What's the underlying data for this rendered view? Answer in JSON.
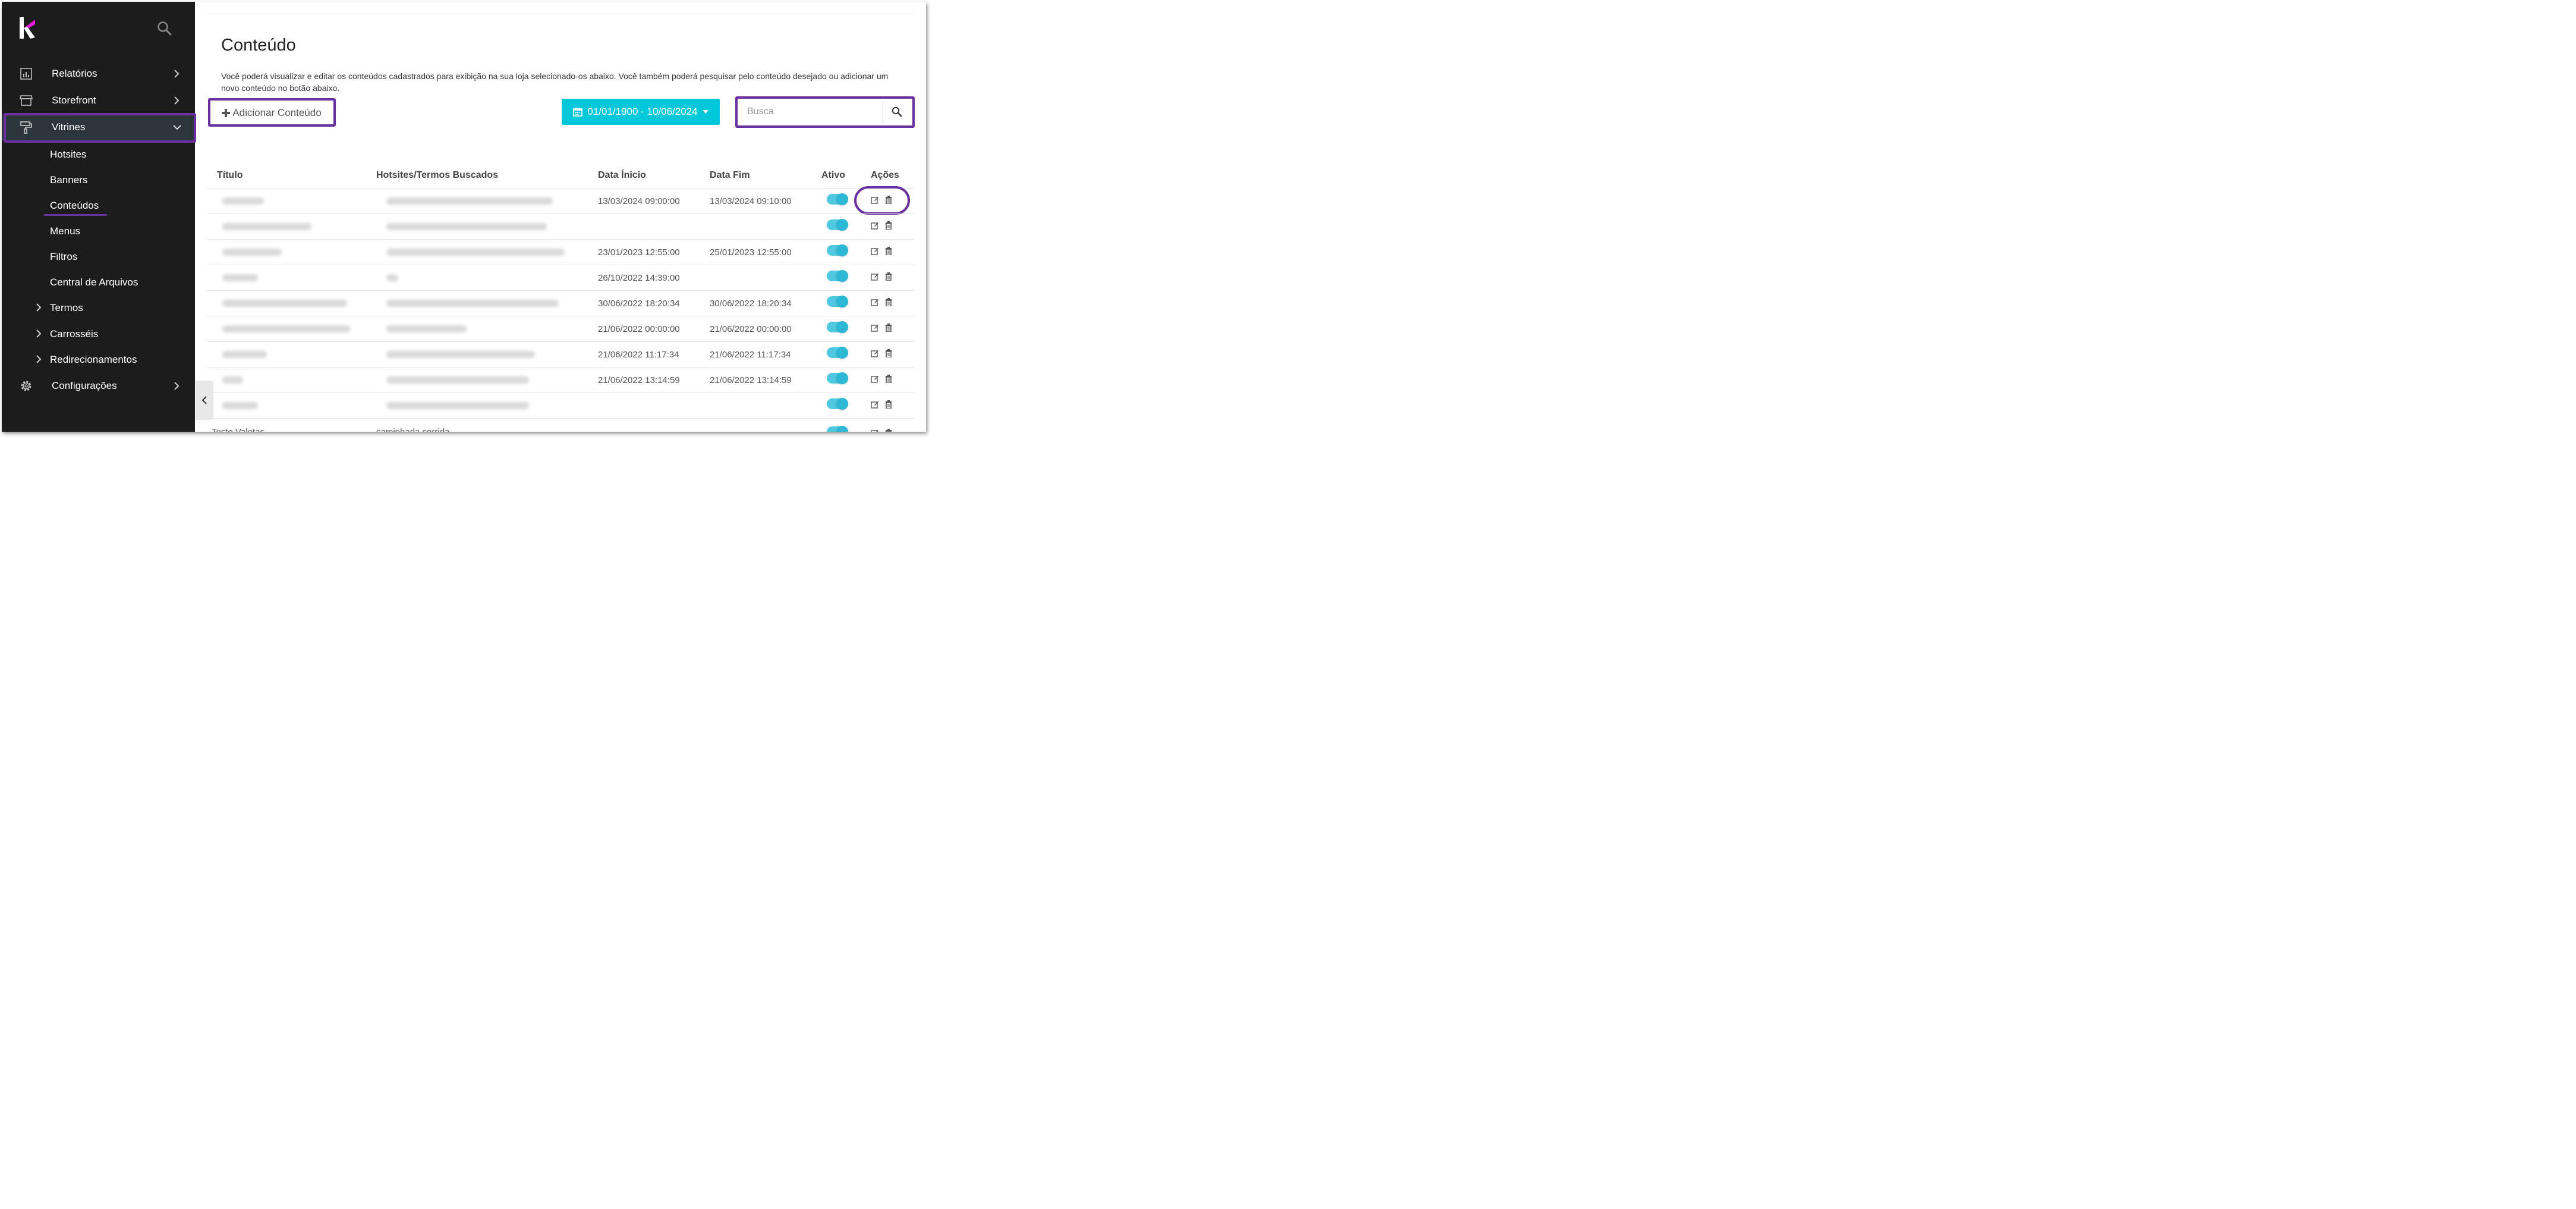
{
  "sidebar": {
    "items": [
      {
        "label": "Relatórios",
        "icon": "bar-chart-icon"
      },
      {
        "label": "Storefront",
        "icon": "storefront-icon"
      },
      {
        "label": "Vitrines",
        "icon": "paint-roller-icon"
      },
      {
        "label": "Configurações",
        "icon": "gear-icon"
      }
    ],
    "subitems": [
      "Hotsites",
      "Banners",
      "Conteúdos",
      "Menus",
      "Filtros",
      "Central de Arquivos",
      "Termos",
      "Carrosséis",
      "Redirecionamentos"
    ],
    "accent_color": "#6b2fa0"
  },
  "main": {
    "title": "Conteúdo",
    "description": "Você poderá visualizar e editar os conteúdos cadastrados para exibição na sua loja selecionado-os abaixo. Você também poderá pesquisar pelo conteúdo desejado ou adicionar um novo conteúdo no botão abaixo.",
    "add_button": "Adicionar Conteúdo",
    "date_range": "01/01/1900 - 10/06/2024",
    "search_placeholder": "Busca",
    "date_button_color": "#00c8d8"
  },
  "table": {
    "headers": {
      "titulo": "Título",
      "hotsites": "Hotsites/Termos Buscados",
      "data_inicio": "Data Ínicio",
      "data_fim": "Data Fim",
      "ativo": "Ativo",
      "acoes": "Ações"
    },
    "rows": [
      {
        "inicio": "13/03/2024 09:00:00",
        "fim": "13/03/2024 09:10:00",
        "ativo": true
      },
      {
        "inicio": "",
        "fim": "",
        "ativo": true
      },
      {
        "inicio": "23/01/2023 12:55:00",
        "fim": "25/01/2023 12:55:00",
        "ativo": true
      },
      {
        "inicio": "26/10/2022 14:39:00",
        "fim": "",
        "ativo": true
      },
      {
        "inicio": "30/06/2022 18:20:34",
        "fim": "30/06/2022 18:20:34",
        "ativo": true
      },
      {
        "inicio": "21/06/2022 00:00:00",
        "fim": "21/06/2022 00:00:00",
        "ativo": true
      },
      {
        "inicio": "21/06/2022 11:17:34",
        "fim": "21/06/2022 11:17:34",
        "ativo": true
      },
      {
        "inicio": "21/06/2022 13:14:59",
        "fim": "21/06/2022 13:14:59",
        "ativo": true
      },
      {
        "inicio": "",
        "fim": "",
        "ativo": true
      }
    ],
    "partial_row": {
      "titulo": "Teste Valetas",
      "hotsites": "caminhada corrida"
    }
  }
}
